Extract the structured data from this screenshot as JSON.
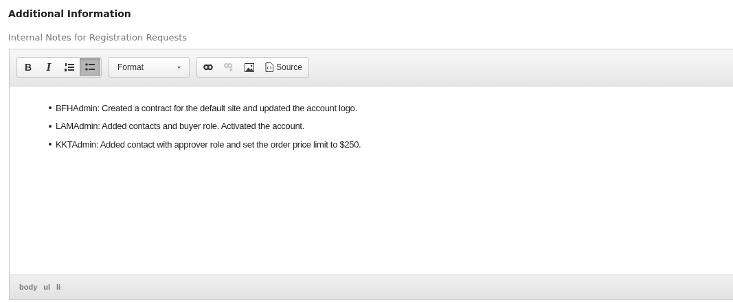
{
  "heading": "Additional Information",
  "field_label": "Internal Notes for Registration Requests",
  "toolbar": {
    "groups": [
      {
        "kind": "buttons",
        "items": [
          {
            "kind": "bold",
            "label": "B",
            "selected": false,
            "disabled": false
          },
          {
            "kind": "italic",
            "label": "I",
            "selected": false,
            "disabled": false
          },
          {
            "kind": "numbered-list",
            "selected": false,
            "disabled": false
          },
          {
            "kind": "bulleted-list",
            "selected": true,
            "disabled": false
          }
        ]
      },
      {
        "kind": "dropdown",
        "label": "Format"
      },
      {
        "kind": "buttons",
        "items": [
          {
            "kind": "link",
            "selected": false,
            "disabled": false
          },
          {
            "kind": "unlink",
            "selected": false,
            "disabled": true
          },
          {
            "kind": "image",
            "selected": false,
            "disabled": false
          },
          {
            "kind": "source",
            "label": "Source",
            "selected": false,
            "disabled": false
          }
        ]
      }
    ]
  },
  "content": [
    "BFHAdmin: Created a contract for the default site and updated the account logo.",
    "LAMAdmin: Added contacts and buyer role. Activated the account.",
    "KKTAdmin: Added contact with approver role and set the order price limit to $250."
  ],
  "path": [
    "body",
    "ul",
    "li"
  ]
}
